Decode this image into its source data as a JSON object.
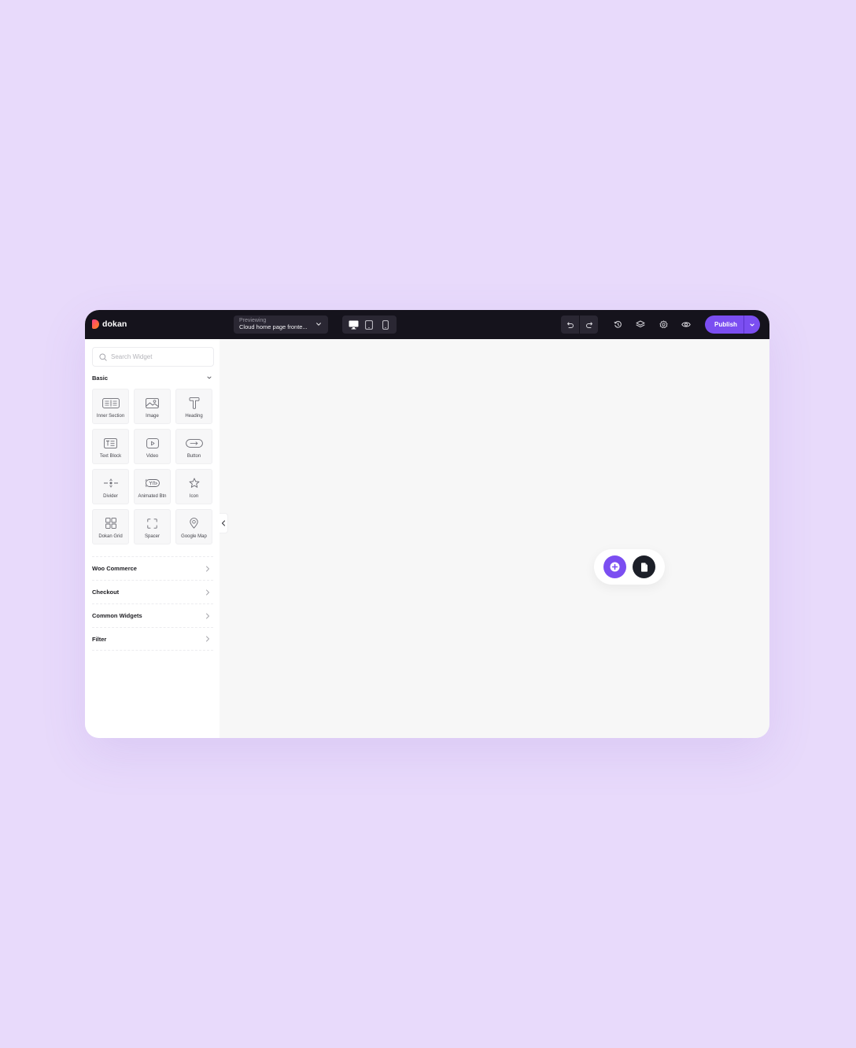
{
  "app": {
    "brand": "dokan",
    "colors": {
      "accent": "#7b4ef1",
      "topbar": "#15131c",
      "background": "#e8dafb",
      "canvas": "#f7f7f7"
    }
  },
  "topbar": {
    "preview": {
      "label": "Previewing",
      "value": "Cloud home page fronte..."
    },
    "devices": [
      {
        "name": "desktop",
        "icon": "desktop-icon",
        "active": true
      },
      {
        "name": "tablet",
        "icon": "tablet-icon",
        "active": false
      },
      {
        "name": "mobile",
        "icon": "mobile-icon",
        "active": false
      }
    ],
    "actions": {
      "undo_icon": "undo-icon",
      "redo_icon": "redo-icon",
      "history_icon": "history-icon",
      "layers_icon": "layers-icon",
      "settings_icon": "gear-icon",
      "preview_icon": "eye-icon"
    },
    "publish_label": "Publish"
  },
  "sidebar": {
    "search_placeholder": "Search Widget",
    "search_value": "",
    "basic_section": {
      "title": "Basic",
      "expanded": true,
      "widgets": [
        {
          "label": "Inner Section",
          "icon": "inner-section-icon"
        },
        {
          "label": "Image",
          "icon": "image-icon"
        },
        {
          "label": "Heading",
          "icon": "heading-icon"
        },
        {
          "label": "Text Block",
          "icon": "text-block-icon"
        },
        {
          "label": "Video",
          "icon": "video-icon"
        },
        {
          "label": "Button",
          "icon": "button-icon"
        },
        {
          "label": "Divider",
          "icon": "divider-icon"
        },
        {
          "label": "Animated Btn",
          "icon": "animated-button-icon"
        },
        {
          "label": "Icon",
          "icon": "star-icon"
        },
        {
          "label": "Dokan Grid",
          "icon": "grid-icon"
        },
        {
          "label": "Spacer",
          "icon": "spacer-icon"
        },
        {
          "label": "Google Map",
          "icon": "map-pin-icon"
        }
      ]
    },
    "categories": [
      {
        "label": "Woo Commerce"
      },
      {
        "label": "Checkout"
      },
      {
        "label": "Common Widgets"
      },
      {
        "label": "Filter"
      }
    ]
  },
  "canvas": {
    "add_section_icon": "plus-circle-icon",
    "template_icon": "file-icon"
  }
}
